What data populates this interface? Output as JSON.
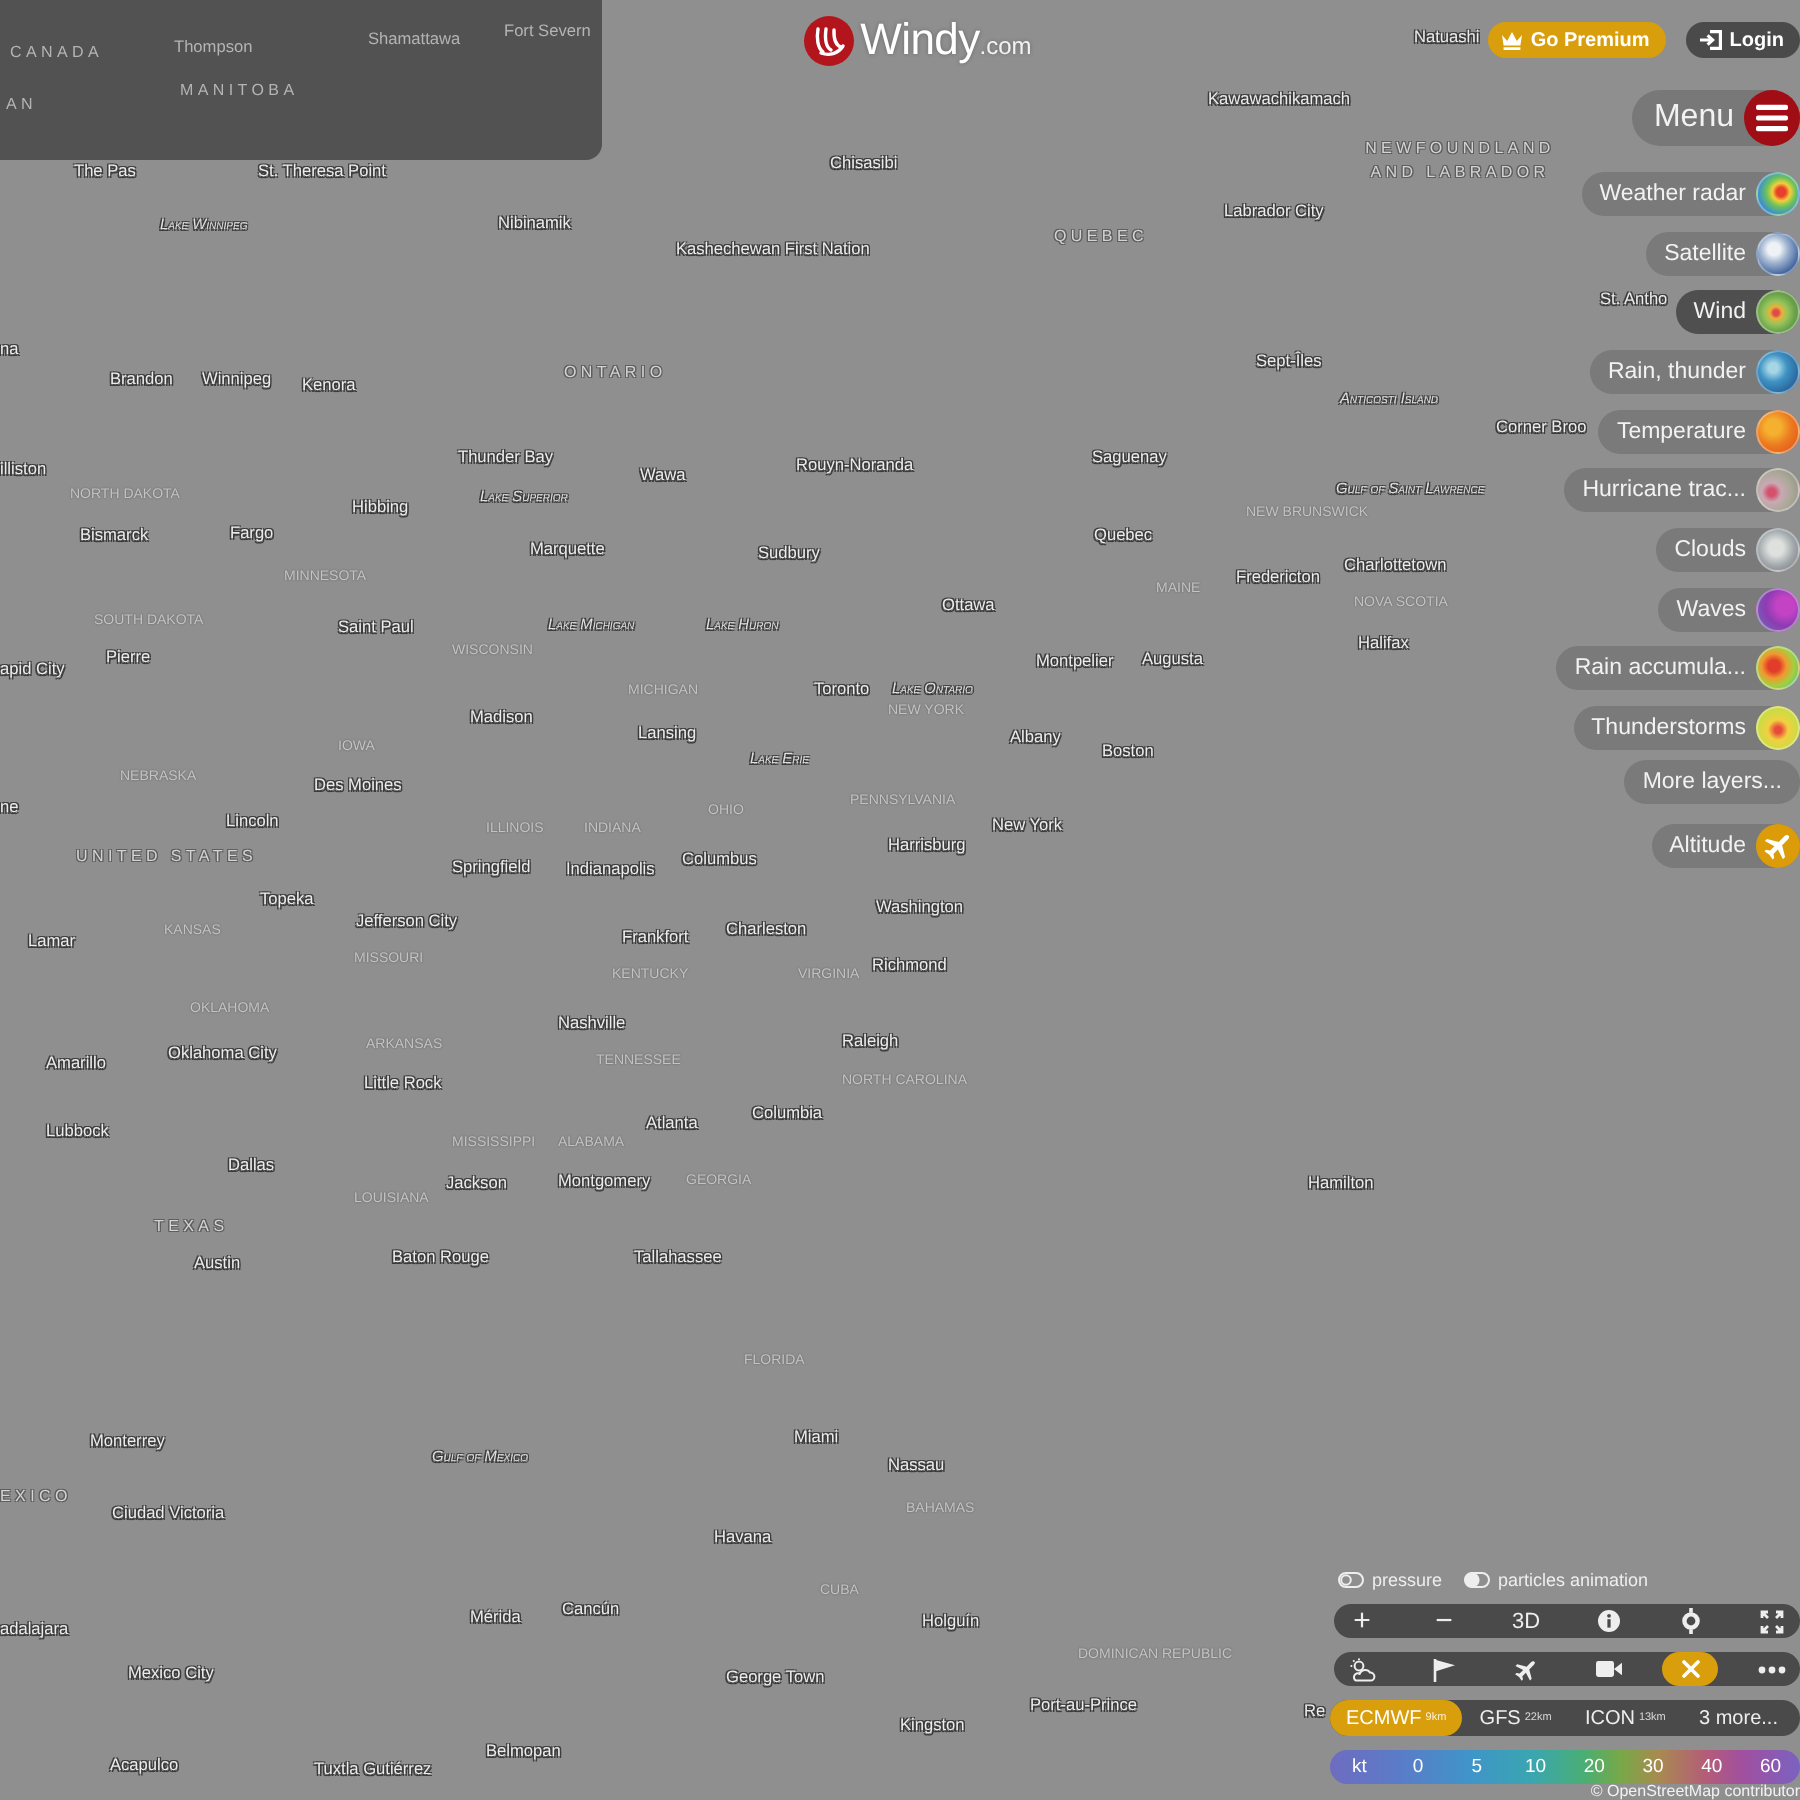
{
  "map_labels": [
    {
      "text": "CANADA",
      "kind": "area"
    },
    {
      "text": "Thompson",
      "kind": "city"
    },
    {
      "text": "Shamattawa",
      "kind": "city"
    },
    {
      "text": "Fort Severn",
      "kind": "city"
    },
    {
      "text": "Natuashi",
      "kind": "city"
    },
    {
      "text": "AN",
      "kind": "area"
    },
    {
      "text": "MANITOBA",
      "kind": "area"
    },
    {
      "text": "Kawawachikamach",
      "kind": "city"
    },
    {
      "text": "The Pas",
      "kind": "city"
    },
    {
      "text": "St. Theresa Point",
      "kind": "city"
    },
    {
      "text": "Chisasibi",
      "kind": "city"
    },
    {
      "text": "NEWFOUNDLAND AND LABRADOR",
      "kind": "area"
    },
    {
      "text": "Lake Winnipeg",
      "kind": "water"
    },
    {
      "text": "Nibinamik",
      "kind": "city"
    },
    {
      "text": "Kashechewan First Nation",
      "kind": "city"
    },
    {
      "text": "QUEBEC",
      "kind": "area"
    },
    {
      "text": "Labrador City",
      "kind": "city"
    },
    {
      "text": "St. Antho",
      "kind": "city"
    },
    {
      "text": "na",
      "kind": "city"
    },
    {
      "text": "Brandon",
      "kind": "city"
    },
    {
      "text": "Winnipeg",
      "kind": "city"
    },
    {
      "text": "Kenora",
      "kind": "city"
    },
    {
      "text": "ONTARIO",
      "kind": "area"
    },
    {
      "text": "Sept-Îles",
      "kind": "city"
    },
    {
      "text": "Anticosti Island",
      "kind": "water"
    },
    {
      "text": "Corner Broo",
      "kind": "city"
    },
    {
      "text": "illiston",
      "kind": "city"
    },
    {
      "text": "NORTH DAKOTA",
      "kind": "state"
    },
    {
      "text": "Hibbing",
      "kind": "city"
    },
    {
      "text": "Thunder Bay",
      "kind": "city"
    },
    {
      "text": "Lake Superior",
      "kind": "water"
    },
    {
      "text": "Wawa",
      "kind": "city"
    },
    {
      "text": "Rouyn-Noranda",
      "kind": "city"
    },
    {
      "text": "Saguenay",
      "kind": "city"
    },
    {
      "text": "NEW BRUNSWICK",
      "kind": "state"
    },
    {
      "text": "Gulf of Saint Lawrence",
      "kind": "water"
    },
    {
      "text": "Bismarck",
      "kind": "city"
    },
    {
      "text": "SOUTH DAKOTA",
      "kind": "state"
    },
    {
      "text": "Fargo",
      "kind": "city"
    },
    {
      "text": "MINNESOTA",
      "kind": "state"
    },
    {
      "text": "Saint Paul",
      "kind": "city"
    },
    {
      "text": "Marquette",
      "kind": "city"
    },
    {
      "text": "Lake Michigan",
      "kind": "water"
    },
    {
      "text": "Lake Huron",
      "kind": "water"
    },
    {
      "text": "Sudbury",
      "kind": "city"
    },
    {
      "text": "Ottawa",
      "kind": "city"
    },
    {
      "text": "Quebec",
      "kind": "city"
    },
    {
      "text": "MAINE",
      "kind": "state"
    },
    {
      "text": "Fredericton",
      "kind": "city"
    },
    {
      "text": "Charlottetown",
      "kind": "city"
    },
    {
      "text": "NOVA SCOTIA",
      "kind": "state"
    },
    {
      "text": "apid City",
      "kind": "city"
    },
    {
      "text": "Pierre",
      "kind": "city"
    },
    {
      "text": "WISCONSIN",
      "kind": "state"
    },
    {
      "text": "Montpelier",
      "kind": "city"
    },
    {
      "text": "Augusta",
      "kind": "city"
    },
    {
      "text": "Halifax",
      "kind": "city"
    },
    {
      "text": "MICHIGAN",
      "kind": "state"
    },
    {
      "text": "Toronto",
      "kind": "city"
    },
    {
      "text": "Lake Ontario",
      "kind": "water"
    },
    {
      "text": "Madison",
      "kind": "city"
    },
    {
      "text": "NEW YORK",
      "kind": "state"
    },
    {
      "text": "IOWA",
      "kind": "state"
    },
    {
      "text": "Lansing",
      "kind": "city"
    },
    {
      "text": "Lake Erie",
      "kind": "water"
    },
    {
      "text": "Albany",
      "kind": "city"
    },
    {
      "text": "Boston",
      "kind": "city"
    },
    {
      "text": "NEBRASKA",
      "kind": "state"
    },
    {
      "text": "Des Moines",
      "kind": "city"
    },
    {
      "text": "ne",
      "kind": "city"
    },
    {
      "text": "Lincoln",
      "kind": "city"
    },
    {
      "text": "ILLINOIS",
      "kind": "state"
    },
    {
      "text": "INDIANA",
      "kind": "state"
    },
    {
      "text": "OHIO",
      "kind": "state"
    },
    {
      "text": "PENNSYLVANIA",
      "kind": "state"
    },
    {
      "text": "New York",
      "kind": "city"
    },
    {
      "text": "UNITED STATES",
      "kind": "area"
    },
    {
      "text": "Springfield",
      "kind": "city"
    },
    {
      "text": "Indianapolis",
      "kind": "city"
    },
    {
      "text": "Columbus",
      "kind": "city"
    },
    {
      "text": "Harrisburg",
      "kind": "city"
    },
    {
      "text": "Lamar",
      "kind": "city"
    },
    {
      "text": "KANSAS",
      "kind": "state"
    },
    {
      "text": "Topeka",
      "kind": "city"
    },
    {
      "text": "Jefferson City",
      "kind": "city"
    },
    {
      "text": "Frankfort",
      "kind": "city"
    },
    {
      "text": "Charleston",
      "kind": "city"
    },
    {
      "text": "Washington",
      "kind": "city"
    },
    {
      "text": "MISSOURI",
      "kind": "state"
    },
    {
      "text": "KENTUCKY",
      "kind": "state"
    },
    {
      "text": "VIRGINIA",
      "kind": "state"
    },
    {
      "text": "Richmond",
      "kind": "city"
    },
    {
      "text": "OKLAHOMA",
      "kind": "state"
    },
    {
      "text": "Nashville",
      "kind": "city"
    },
    {
      "text": "Amarillo",
      "kind": "city"
    },
    {
      "text": "Oklahoma City",
      "kind": "city"
    },
    {
      "text": "ARKANSAS",
      "kind": "state"
    },
    {
      "text": "TENNESSEE",
      "kind": "state"
    },
    {
      "text": "Raleigh",
      "kind": "city"
    },
    {
      "text": "Little Rock",
      "kind": "city"
    },
    {
      "text": "NORTH CAROLINA",
      "kind": "state"
    },
    {
      "text": "Lubbock",
      "kind": "city"
    },
    {
      "text": "MISSISSIPPI",
      "kind": "state"
    },
    {
      "text": "ALABAMA",
      "kind": "state"
    },
    {
      "text": "Atlanta",
      "kind": "city"
    },
    {
      "text": "Columbia",
      "kind": "city"
    },
    {
      "text": "Dallas",
      "kind": "city"
    },
    {
      "text": "LOUISIANA",
      "kind": "state"
    },
    {
      "text": "Jackson",
      "kind": "city"
    },
    {
      "text": "Montgomery",
      "kind": "city"
    },
    {
      "text": "GEORGIA",
      "kind": "state"
    },
    {
      "text": "Hamilton",
      "kind": "city"
    },
    {
      "text": "TEXAS",
      "kind": "area"
    },
    {
      "text": "Austin",
      "kind": "city"
    },
    {
      "text": "Baton Rouge",
      "kind": "city"
    },
    {
      "text": "Tallahassee",
      "kind": "city"
    },
    {
      "text": "FLORIDA",
      "kind": "state"
    },
    {
      "text": "Monterrey",
      "kind": "city"
    },
    {
      "text": "Gulf of Mexico",
      "kind": "water"
    },
    {
      "text": "Miami",
      "kind": "city"
    },
    {
      "text": "Nassau",
      "kind": "city"
    },
    {
      "text": "EXICO",
      "kind": "area"
    },
    {
      "text": "Ciudad Victoria",
      "kind": "city"
    },
    {
      "text": "BAHAMAS",
      "kind": "state"
    },
    {
      "text": "Havana",
      "kind": "city"
    },
    {
      "text": "CUBA",
      "kind": "state"
    },
    {
      "text": "adalajara",
      "kind": "city"
    },
    {
      "text": "Mérida",
      "kind": "city"
    },
    {
      "text": "Cancún",
      "kind": "city"
    },
    {
      "text": "Holguín",
      "kind": "city"
    },
    {
      "text": "Mexico City",
      "kind": "city"
    },
    {
      "text": "George Town",
      "kind": "city"
    },
    {
      "text": "DOMINICAN REPUBLIC",
      "kind": "state"
    },
    {
      "text": "Kingston",
      "kind": "city"
    },
    {
      "text": "Port-au-Prince",
      "kind": "city"
    },
    {
      "text": "Re",
      "kind": "city"
    },
    {
      "text": "Acapulco",
      "kind": "city"
    },
    {
      "text": "Tuxtla Gutiérrez",
      "kind": "city"
    },
    {
      "text": "Belmopan",
      "kind": "city"
    }
  ],
  "header": {
    "logo": {
      "name": "Windy",
      "suffix": ".com"
    },
    "premium_button": "Go Premium",
    "login_button": "Login"
  },
  "menu": {
    "label": "Menu"
  },
  "layers": [
    {
      "label": "Weather radar",
      "kind": "radar",
      "selected": false
    },
    {
      "label": "Satellite",
      "kind": "satellite",
      "selected": false
    },
    {
      "label": "Wind",
      "kind": "wind",
      "selected": true
    },
    {
      "label": "Rain, thunder",
      "kind": "rain",
      "selected": false
    },
    {
      "label": "Temperature",
      "kind": "temperature",
      "selected": false
    },
    {
      "label": "Hurricane trac...",
      "kind": "hurricane",
      "selected": false
    },
    {
      "label": "Clouds",
      "kind": "clouds",
      "selected": false
    },
    {
      "label": "Waves",
      "kind": "waves",
      "selected": false
    },
    {
      "label": "Rain accumula...",
      "kind": "accumulation",
      "selected": false
    },
    {
      "label": "Thunderstorms",
      "kind": "thunderstorms",
      "selected": false
    },
    {
      "label": "More layers...",
      "kind": "more",
      "selected": false
    },
    {
      "label": "Altitude",
      "kind": "altitude",
      "selected": false
    }
  ],
  "toggles": [
    {
      "label": "pressure",
      "on": false
    },
    {
      "label": "particles animation",
      "on": true
    }
  ],
  "view_controls": [
    {
      "kind": "zoom-in",
      "label": "+"
    },
    {
      "kind": "zoom-out",
      "label": "−"
    },
    {
      "kind": "view-3d",
      "label": "3D"
    },
    {
      "kind": "info"
    },
    {
      "kind": "locate"
    },
    {
      "kind": "fullscreen"
    }
  ],
  "tools": [
    {
      "kind": "weather",
      "selected": false
    },
    {
      "kind": "windsock",
      "selected": false
    },
    {
      "kind": "airport",
      "selected": false
    },
    {
      "kind": "webcam",
      "selected": false
    },
    {
      "kind": "close",
      "selected": true
    },
    {
      "kind": "more",
      "selected": false
    }
  ],
  "models": [
    {
      "name": "ECMWF",
      "resolution": "9km",
      "selected": true
    },
    {
      "name": "GFS",
      "resolution": "22km",
      "selected": false
    },
    {
      "name": "ICON",
      "resolution": "13km",
      "selected": false
    },
    {
      "name": "3 more...",
      "selected": false
    }
  ],
  "legend": {
    "unit": "kt",
    "values": [
      "0",
      "5",
      "10",
      "20",
      "30",
      "40",
      "60"
    ]
  },
  "attribution": "© OpenStreetMap contributor"
}
